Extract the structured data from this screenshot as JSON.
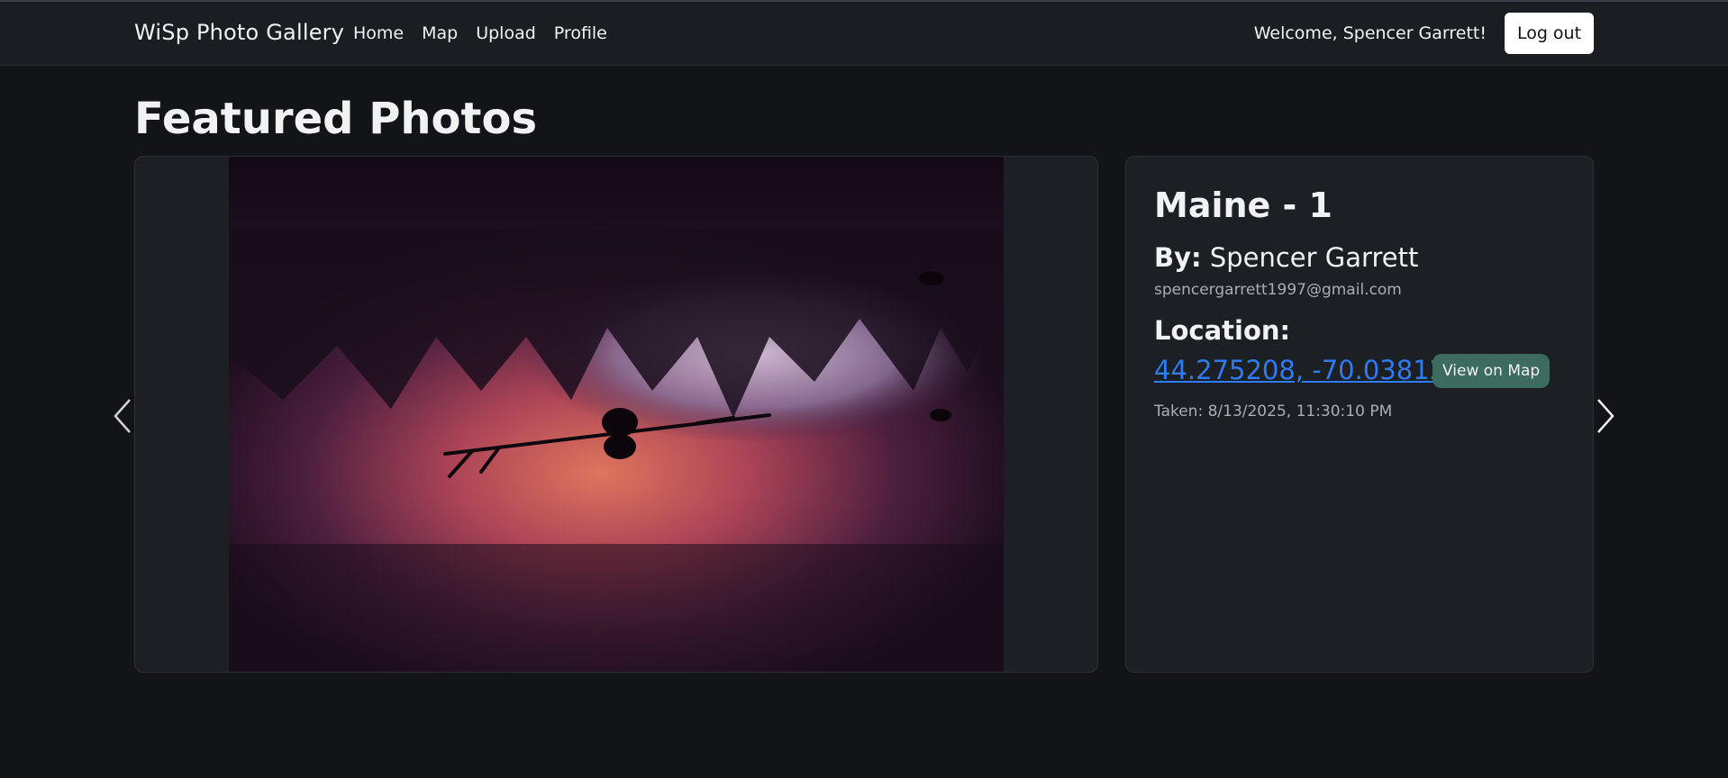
{
  "navbar": {
    "brand": "WiSp Photo Gallery",
    "links": [
      {
        "label": "Home"
      },
      {
        "label": "Map"
      },
      {
        "label": "Upload"
      },
      {
        "label": "Profile"
      }
    ],
    "welcome": "Welcome, Spencer Garrett!",
    "logout_label": "Log out"
  },
  "main": {
    "title": "Featured Photos"
  },
  "photo_info": {
    "title": "Maine - 1",
    "by_label": "By:",
    "author": "Spencer Garrett",
    "email": "spencergarrett1997@gmail.com",
    "location_label": "Location:",
    "coordinates": "44.275208, -70.038121",
    "map_button_label": "View on Map",
    "taken": "Taken: 8/13/2025, 11:30:10 PM"
  },
  "carousel": {
    "prev_icon": "chevron-left-icon",
    "next_icon": "chevron-right-icon"
  },
  "colors": {
    "page_bg": "#121418",
    "navbar_bg": "#1a1d21",
    "card_bg": "#1c2024",
    "link": "#2f7af5",
    "map_button": "#3d6b5f"
  }
}
